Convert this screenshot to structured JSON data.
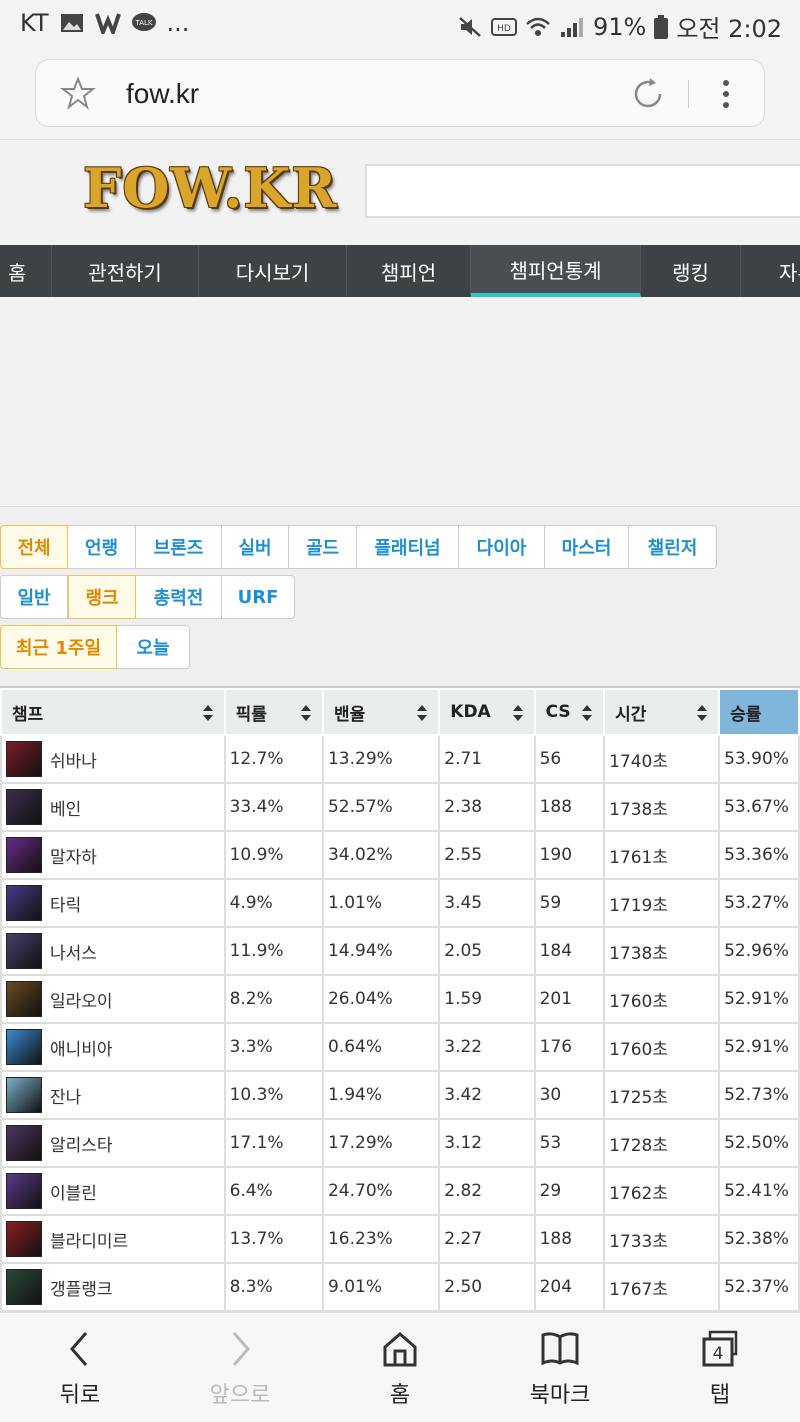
{
  "status_bar": {
    "carrier": "KT",
    "more": "...",
    "battery": "91%",
    "time": "오전 2:02"
  },
  "browser": {
    "url": "fow.kr"
  },
  "site": {
    "logo": "FOW.KR",
    "nav": [
      "홈",
      "관전하기",
      "다시보기",
      "챔피언",
      "챔피언통계",
      "랭킹",
      "자유"
    ]
  },
  "filters": {
    "tier": [
      "전체",
      "언랭",
      "브론즈",
      "실버",
      "골드",
      "플래티넘",
      "다이아",
      "마스터",
      "챌린저"
    ],
    "mode": [
      "일반",
      "랭크",
      "총력전",
      "URF"
    ],
    "period": [
      "최근 1주일",
      "오늘"
    ],
    "selected_tier": "전체",
    "selected_mode": "랭크",
    "selected_period": "최근 1주일"
  },
  "table": {
    "headers": [
      "챔프",
      "픽률",
      "밴율",
      "KDA",
      "CS",
      "시간",
      "승률"
    ],
    "rows": [
      {
        "name": "쉬바나",
        "pick": "12.7%",
        "ban": "13.29%",
        "kda": "2.71",
        "cs": "56",
        "time": "1740초",
        "win": "53.90%",
        "color": "#7a1e2a"
      },
      {
        "name": "베인",
        "pick": "33.4%",
        "ban": "52.57%",
        "kda": "2.38",
        "cs": "188",
        "time": "1738초",
        "win": "53.67%",
        "color": "#3a2f4a"
      },
      {
        "name": "말자하",
        "pick": "10.9%",
        "ban": "34.02%",
        "kda": "2.55",
        "cs": "190",
        "time": "1761초",
        "win": "53.36%",
        "color": "#6a2a8a"
      },
      {
        "name": "타릭",
        "pick": "4.9%",
        "ban": "1.01%",
        "kda": "3.45",
        "cs": "59",
        "time": "1719초",
        "win": "53.27%",
        "color": "#4a3a8a"
      },
      {
        "name": "나서스",
        "pick": "11.9%",
        "ban": "14.94%",
        "kda": "2.05",
        "cs": "184",
        "time": "1738초",
        "win": "52.96%",
        "color": "#4a3f6a"
      },
      {
        "name": "일라오이",
        "pick": "8.2%",
        "ban": "26.04%",
        "kda": "1.59",
        "cs": "201",
        "time": "1760초",
        "win": "52.91%",
        "color": "#6a4a22"
      },
      {
        "name": "애니비아",
        "pick": "3.3%",
        "ban": "0.64%",
        "kda": "3.22",
        "cs": "176",
        "time": "1760초",
        "win": "52.91%",
        "color": "#3a8ad0"
      },
      {
        "name": "잔나",
        "pick": "10.3%",
        "ban": "1.94%",
        "kda": "3.42",
        "cs": "30",
        "time": "1725초",
        "win": "52.73%",
        "color": "#7ab0c8"
      },
      {
        "name": "알리스타",
        "pick": "17.1%",
        "ban": "17.29%",
        "kda": "3.12",
        "cs": "53",
        "time": "1728초",
        "win": "52.50%",
        "color": "#4a3560"
      },
      {
        "name": "이블린",
        "pick": "6.4%",
        "ban": "24.70%",
        "kda": "2.82",
        "cs": "29",
        "time": "1762초",
        "win": "52.41%",
        "color": "#5a3a8a"
      },
      {
        "name": "블라디미르",
        "pick": "13.7%",
        "ban": "16.23%",
        "kda": "2.27",
        "cs": "188",
        "time": "1733초",
        "win": "52.38%",
        "color": "#8a2020"
      },
      {
        "name": "갱플랭크",
        "pick": "8.3%",
        "ban": "9.01%",
        "kda": "2.50",
        "cs": "204",
        "time": "1767초",
        "win": "52.37%",
        "color": "#2a4a3a"
      }
    ]
  },
  "bottom_bar": {
    "back": "뒤로",
    "forward": "앞으로",
    "home": "홈",
    "bookmarks": "북마크",
    "tabs": "탭",
    "tab_count": "4"
  },
  "colors": {
    "nav_bg": "#3d4244",
    "nav_active_underline": "#2ec4c8",
    "link_blue": "#1e8fd0",
    "selected_orange": "#e08a00",
    "winrate_header": "#7fb6d9"
  }
}
